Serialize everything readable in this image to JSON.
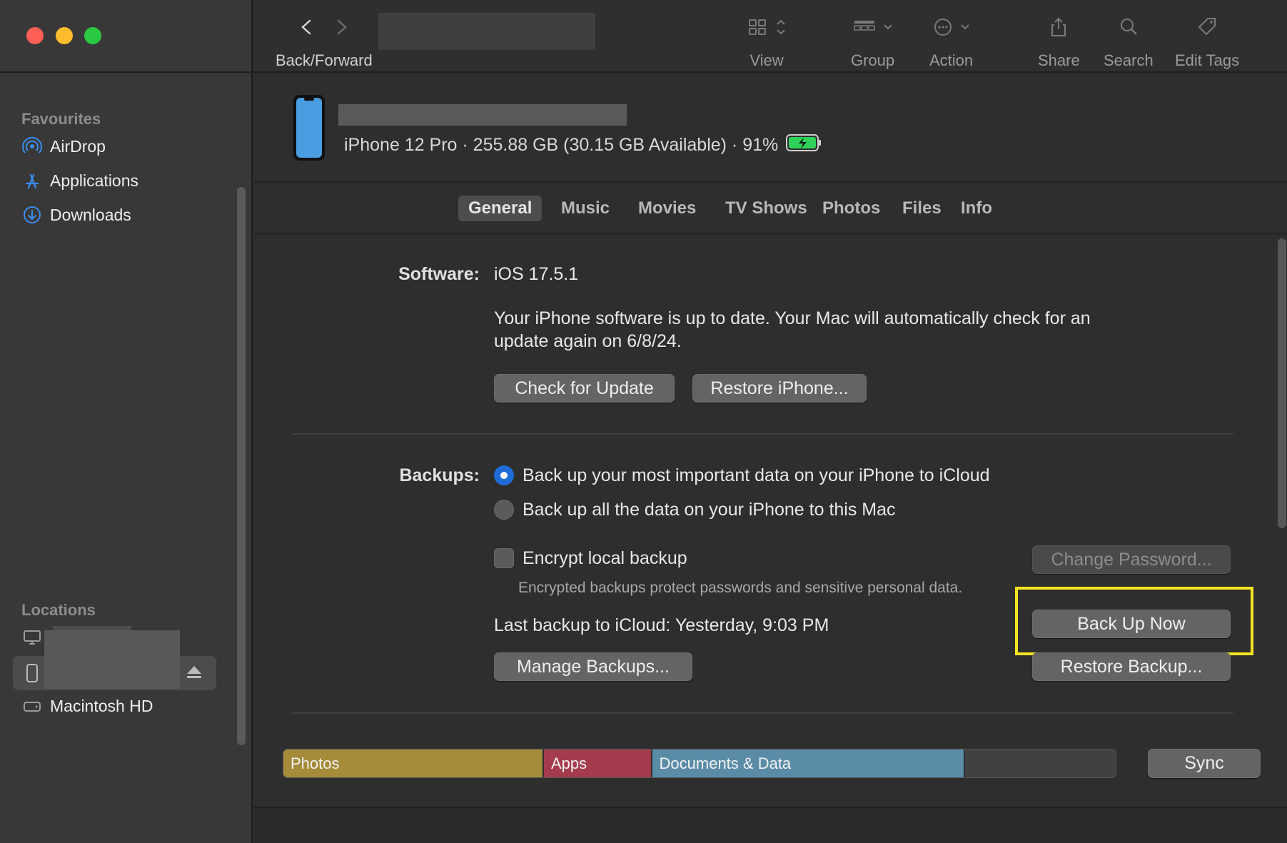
{
  "window": {
    "traffic_lights": [
      "close",
      "minimize",
      "zoom"
    ]
  },
  "sidebar": {
    "favourites_title": "Favourites",
    "favourites": [
      {
        "label": "AirDrop",
        "icon": "airdrop-icon"
      },
      {
        "label": "Applications",
        "icon": "applications-icon"
      },
      {
        "label": "Downloads",
        "icon": "downloads-icon"
      }
    ],
    "locations_title": "Locations",
    "locations": [
      {
        "label": "",
        "icon": "computer-icon"
      },
      {
        "label": "",
        "icon": "iphone-icon"
      },
      {
        "label": "Macintosh HD",
        "icon": "hard-drive-icon"
      }
    ]
  },
  "toolbar": {
    "back_forward_label": "Back/Forward",
    "view_label": "View",
    "group_label": "Group",
    "action_label": "Action",
    "share_label": "Share",
    "search_label": "Search",
    "edit_tags_label": "Edit Tags"
  },
  "device": {
    "info": "iPhone 12 Pro · 255.88 GB (30.15 GB Available) · 91%",
    "battery_percent": 91,
    "charging": true
  },
  "tabs": [
    {
      "label": "General",
      "active": true
    },
    {
      "label": "Music"
    },
    {
      "label": "Movies"
    },
    {
      "label": "TV Shows"
    },
    {
      "label": "Photos"
    },
    {
      "label": "Files"
    },
    {
      "label": "Info"
    }
  ],
  "software": {
    "label": "Software:",
    "version": "iOS 17.5.1",
    "message_line1": "Your iPhone software is up to date. Your Mac will automatically check for an",
    "message_line2": "update again on 6/8/24.",
    "check_update_button": "Check for Update",
    "restore_iphone_button": "Restore iPhone..."
  },
  "backups": {
    "label": "Backups:",
    "option_icloud": "Back up your most important data on your iPhone to iCloud",
    "option_mac": "Back up all the data on your iPhone to this Mac",
    "selected": "icloud",
    "encrypt_label": "Encrypt local backup",
    "encrypt_checked": false,
    "encrypt_hint": "Encrypted backups protect passwords and sensitive personal data.",
    "change_password_button": "Change Password...",
    "last_backup": "Last backup to iCloud:  Yesterday, 9:03 PM",
    "back_up_now_button": "Back Up Now",
    "manage_backups_button": "Manage Backups...",
    "restore_backup_button": "Restore Backup..."
  },
  "storage": {
    "segments": [
      {
        "label": "Photos",
        "color": "#a58b3a",
        "fraction": 0.313
      },
      {
        "label": "Apps",
        "color": "#a53c4e",
        "fraction": 0.13
      },
      {
        "label": "Documents & Data",
        "color": "#5a8ca8",
        "fraction": 0.376
      }
    ],
    "free_color": "#414141",
    "sync_button": "Sync"
  },
  "colors": {
    "accent": "#1f6bd8",
    "highlight": "#f2e422"
  }
}
